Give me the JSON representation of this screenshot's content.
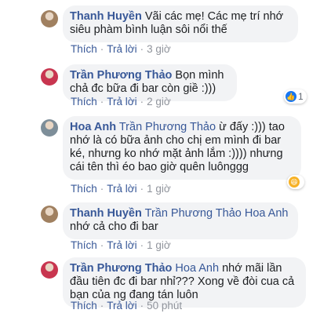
{
  "comments": [
    {
      "author": "Thanh Huyền",
      "tag": "",
      "text": "Vãi các mẹ! Các mẹ trí nhớ siêu phàm bình luận sôi nổi thế",
      "like": "Thích",
      "reply": "Trả lời",
      "time": "3 giờ",
      "avatar_color": "#a08060"
    },
    {
      "author": "Trần Phương Thảo",
      "tag": "",
      "text": "Bọn mình chả đc bữa đi bar còn giề :)))",
      "like": "Thích",
      "reply": "Trả lời",
      "time": "2 giờ",
      "avatar_color": "#c8354f",
      "reaction": {
        "icon": "like-icon",
        "count": "1",
        "color": "#1877f2"
      }
    },
    {
      "author": "Hoa Anh",
      "tag": "Trần Phương Thảo",
      "text": "ừ đấy :))) tao nhớ là có bữa ảnh cho chị em mình đi bar ké, nhưng ko nhớ mặt ảnh lắm :)))) nhưng cái tên thì éo bao giờ quên luônggg",
      "like": "Thích",
      "reply": "Trả lời",
      "time": "1 giờ",
      "avatar_color": "#7d8e99",
      "reaction": {
        "icon": "haha-icon",
        "count": "",
        "color": "#f7b125"
      }
    },
    {
      "author": "Thanh Huyền",
      "tag": "Trần Phương Thảo Hoa Anh",
      "text": "nhớ cả cho đi bar",
      "like": "Thích",
      "reply": "Trả lời",
      "time": "1 giờ",
      "avatar_color": "#a08060"
    },
    {
      "author": "Trần Phương Thảo",
      "tag": "Hoa Anh",
      "text": "nhớ mãi lần đầu tiên đc đi bar nhỉ??? Xong về đòi cua cả bạn của ng đang tán luôn",
      "like": "Thích",
      "reply": "Trả lời",
      "time": "50 phút",
      "avatar_color": "#c8354f"
    }
  ]
}
